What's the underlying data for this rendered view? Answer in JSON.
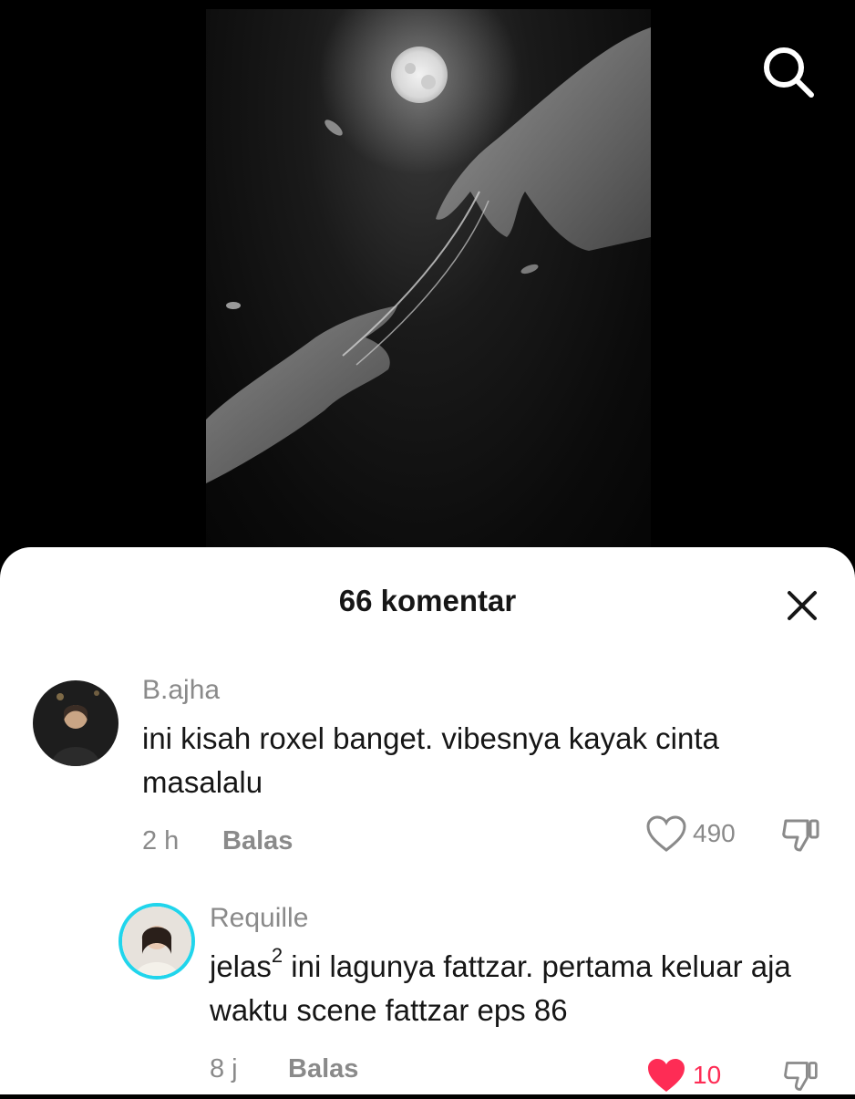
{
  "header": {
    "search_icon": "search-icon"
  },
  "comments_panel": {
    "title": "66 komentar",
    "close_icon": "close-icon"
  },
  "comments": [
    {
      "username": "B.ajha",
      "text": "ini kisah roxel banget. vibesnya kayak cinta masalalu",
      "time": "2 h",
      "reply_label": "Balas",
      "likes": "490",
      "liked": false
    },
    {
      "username": "Requille",
      "text_prefix": "jelas",
      "text_sup": "2",
      "text_rest": " ini lagunya fattzar. pertama keluar aja waktu scene fattzar eps 86",
      "time": "8 j",
      "reply_label": "Balas",
      "likes": "10",
      "liked": true,
      "has_story_ring": true
    }
  ],
  "colors": {
    "like_active": "#fe2c55",
    "story_ring": "#20d5ec",
    "muted_text": "#8a8a8a"
  }
}
